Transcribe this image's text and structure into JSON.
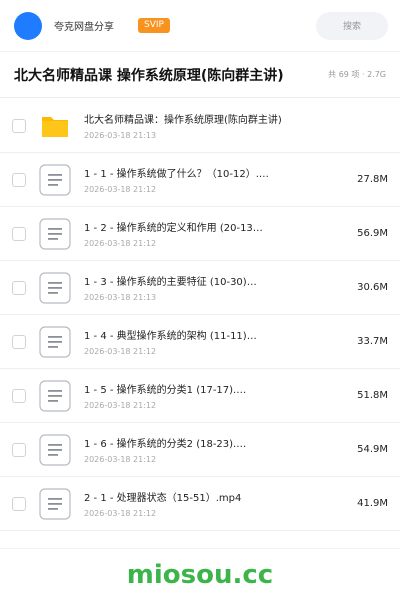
{
  "header": {
    "username": "夸克网盘分享",
    "badge": "SVIP",
    "search_placeholder": "搜索"
  },
  "folder": {
    "title": "北大名师精品课 操作系统原理(陈向群主讲)",
    "stats": "共 69 项 · 2.7G"
  },
  "files": [
    {
      "type": "folder",
      "name": "北大名师精品课：操作系统原理(陈向群主讲)",
      "date": "2026-03-18 21:13",
      "size": ""
    },
    {
      "type": "video",
      "name": "1 - 1 - 操作系统做了什么？（10-12）.…",
      "date": "2026-03-18 21:12",
      "size": "27.8M"
    },
    {
      "type": "video",
      "name": "1 - 2 - 操作系统的定义和作用 (20-13…",
      "date": "2026-03-18 21:12",
      "size": "56.9M"
    },
    {
      "type": "video",
      "name": "1 - 3 - 操作系统的主要特征 (10-30)…",
      "date": "2026-03-18 21:13",
      "size": "30.6M"
    },
    {
      "type": "video",
      "name": "1 - 4 - 典型操作系统的架构 (11-11)…",
      "date": "2026-03-18 21:12",
      "size": "33.7M"
    },
    {
      "type": "video",
      "name": "1 - 5 - 操作系统的分类1 (17-17).…",
      "date": "2026-03-18 21:12",
      "size": "51.8M"
    },
    {
      "type": "video",
      "name": "1 - 6 - 操作系统的分类2 (18-23).…",
      "date": "2026-03-18 21:12",
      "size": "54.9M"
    },
    {
      "type": "video",
      "name": "2 - 1 - 处理器状态（15-51）.mp4",
      "date": "2026-03-18 21:12",
      "size": "41.9M"
    }
  ],
  "watermark": "miosou.cc",
  "colors": {
    "accent": "#1f7cff",
    "svip": "#f7931e",
    "folder": "#ffc61a",
    "watermark": "#3cb44a"
  }
}
